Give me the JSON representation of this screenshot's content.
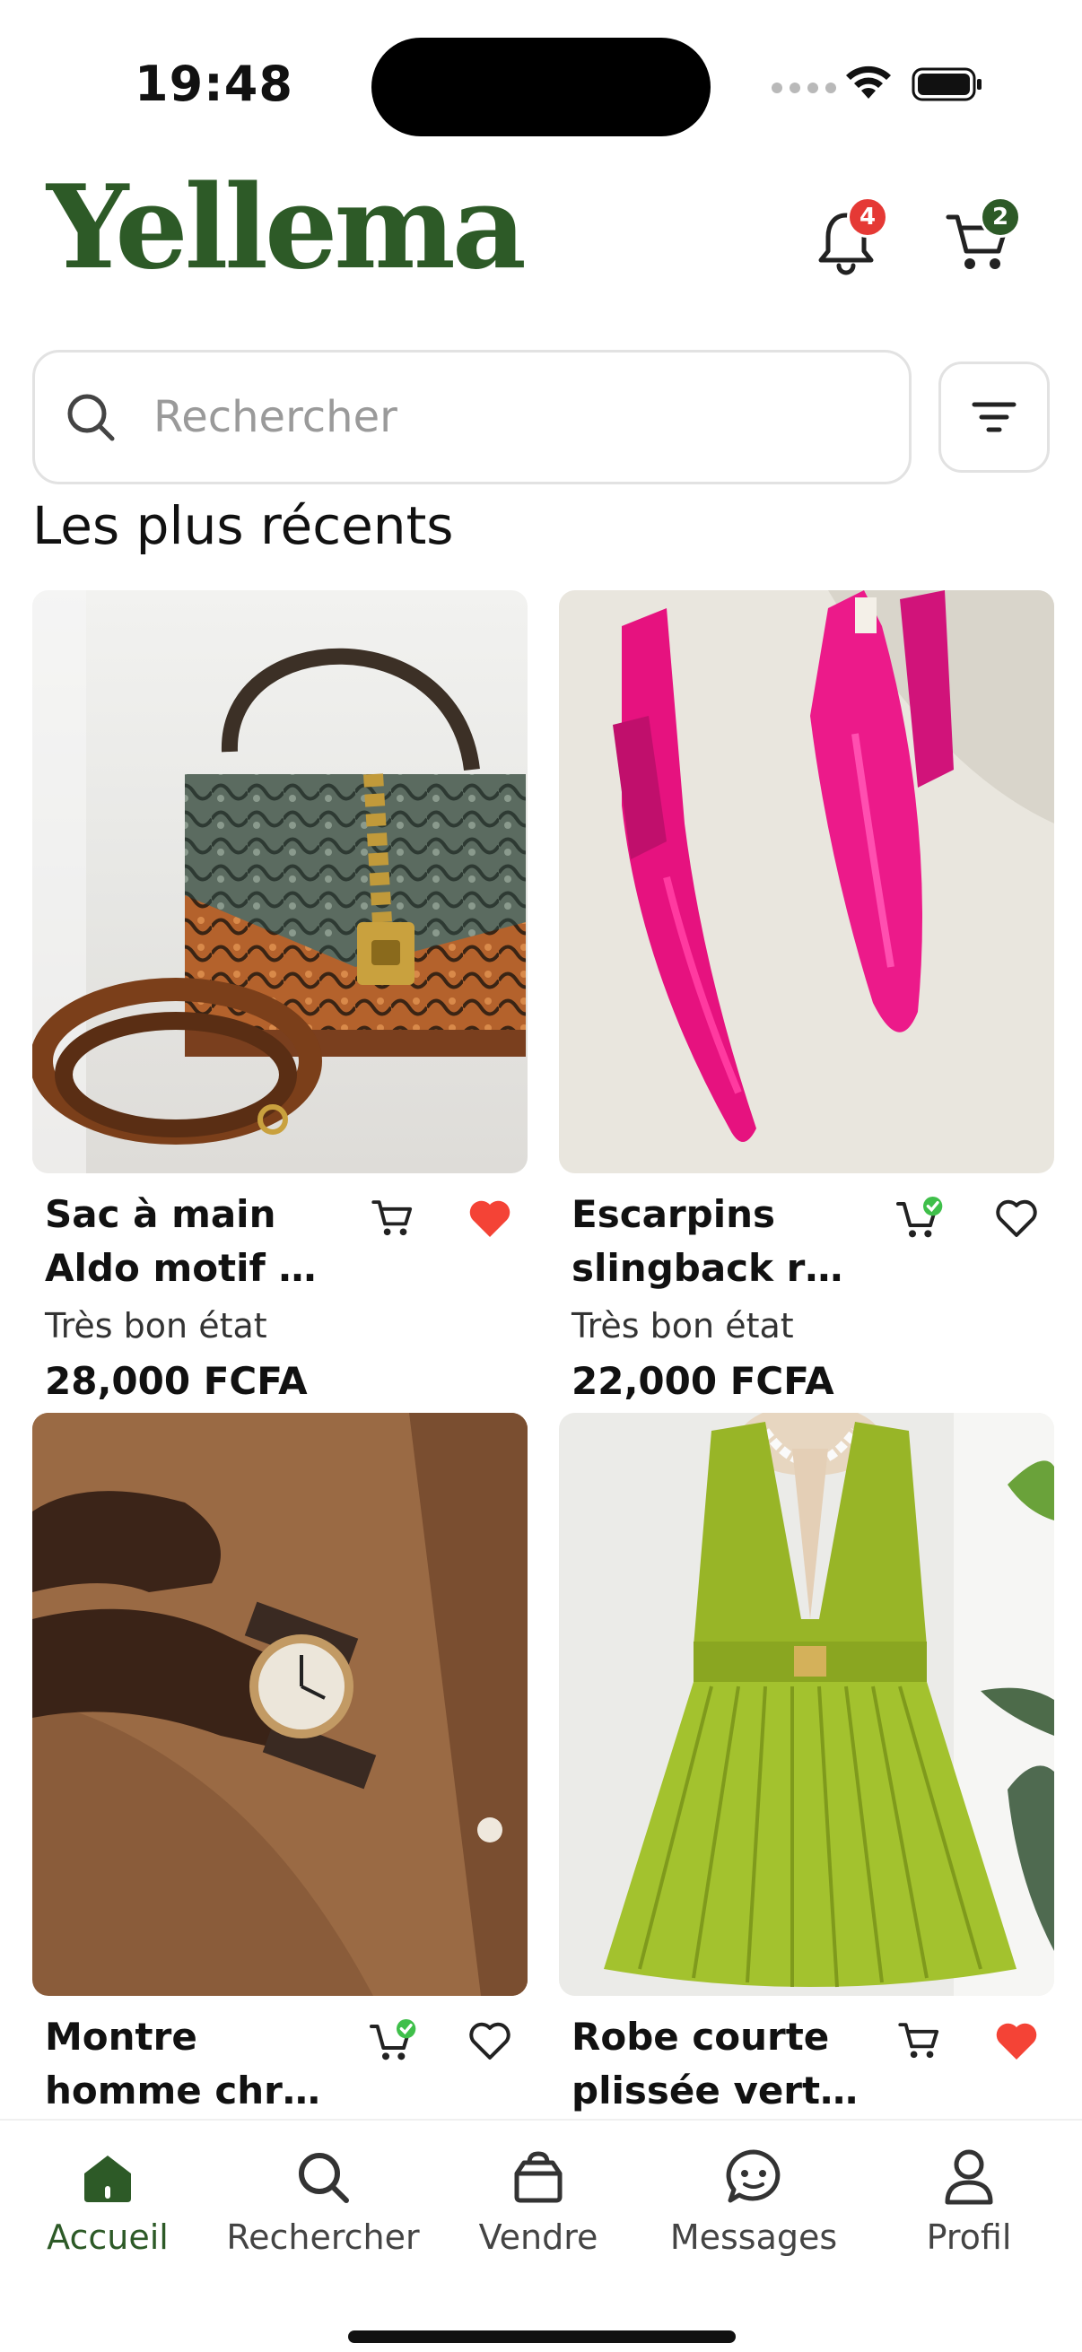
{
  "status": {
    "time": "19:48"
  },
  "header": {
    "logo": "Yellema",
    "notifications_count": "4",
    "cart_count": "2"
  },
  "search": {
    "placeholder": "Rechercher"
  },
  "section_title": "Les plus récents",
  "products": [
    {
      "name_line1": "Sac à main",
      "name_line2": "Aldo motif py…",
      "condition": "Très bon état",
      "price": "28,000 FCFA",
      "in_cart": false,
      "favorite": true,
      "image": "snake-print-handbag"
    },
    {
      "name_line1": "Escarpins",
      "name_line2": "slingback ros…",
      "condition": "Très bon état",
      "price": "22,000 FCFA",
      "in_cart": true,
      "favorite": false,
      "image": "pink-slingback-pumps"
    },
    {
      "name_line1": "Montre",
      "name_line2": "homme chro…",
      "condition": "",
      "price": "",
      "in_cart": true,
      "favorite": false,
      "image": "mens-chronograph-watch"
    },
    {
      "name_line1": "Robe courte",
      "name_line2": "plissée vert a…",
      "condition": "",
      "price": "",
      "in_cart": false,
      "favorite": true,
      "image": "green-pleated-dress"
    }
  ],
  "tabs": [
    {
      "label": "Accueil",
      "icon": "home-icon",
      "active": true
    },
    {
      "label": "Rechercher",
      "icon": "search-icon",
      "active": false
    },
    {
      "label": "Vendre",
      "icon": "bag-icon",
      "active": false
    },
    {
      "label": "Messages",
      "icon": "chat-icon",
      "active": false
    },
    {
      "label": "Profil",
      "icon": "user-icon",
      "active": false
    }
  ],
  "colors": {
    "brand_green": "#2d5a27",
    "badge_red": "#e53935",
    "heart_red": "#f44336",
    "cart_check_green": "#3fbf4a"
  }
}
